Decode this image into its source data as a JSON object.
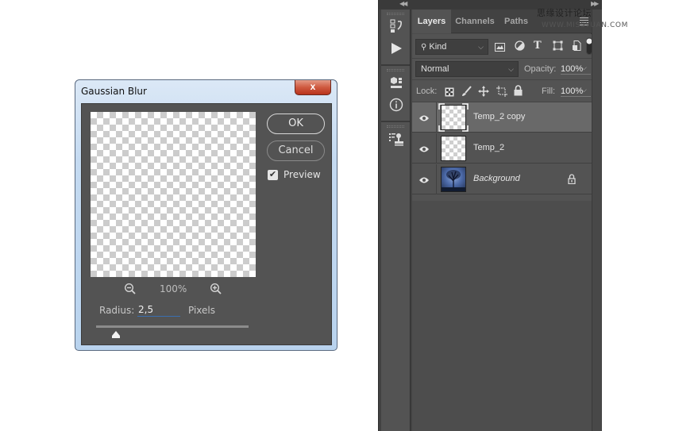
{
  "dialog": {
    "title": "Gaussian Blur",
    "close_label": "x",
    "ok_label": "OK",
    "cancel_label": "Cancel",
    "preview_label": "Preview",
    "preview_checked": true,
    "zoom_level": "100%",
    "radius_label": "Radius:",
    "radius_value": "2,5",
    "radius_unit": "Pixels",
    "radius_slider_fraction": 0.13
  },
  "panels": {
    "tabs": [
      {
        "label": "Layers",
        "active": true
      },
      {
        "label": "Channels",
        "active": false
      },
      {
        "label": "Paths",
        "active": false
      }
    ],
    "filter": {
      "kind_label": "Kind",
      "filter_icons": [
        "image-filter-icon",
        "adjustment-filter-icon",
        "type-filter-icon",
        "shape-filter-icon",
        "smart-object-filter-icon"
      ],
      "toggle": "filter-toggle"
    },
    "blend_mode": "Normal",
    "opacity_label": "Opacity:",
    "opacity_value": "100%",
    "lock_label": "Lock:",
    "lock_icons": [
      "lock-transparent-icon",
      "lock-image-icon",
      "lock-position-icon",
      "lock-artboard-icon",
      "lock-all-icon"
    ],
    "fill_label": "Fill:",
    "fill_value": "100%",
    "layers": [
      {
        "name": "Temp_2 copy",
        "visible": true,
        "selected": true,
        "type": "transparent",
        "locked": false
      },
      {
        "name": "Temp_2",
        "visible": true,
        "selected": false,
        "type": "transparent",
        "locked": false
      },
      {
        "name": "Background",
        "visible": true,
        "selected": false,
        "type": "image",
        "locked": true
      }
    ],
    "toolbar_icons": [
      "history-icon",
      "actions-play-icon",
      "3d-icon",
      "info-icon",
      "clone-source-icon"
    ]
  },
  "watermark": {
    "text": "思缘设计论坛",
    "url": "WWW.MISSYUAN.COM"
  }
}
